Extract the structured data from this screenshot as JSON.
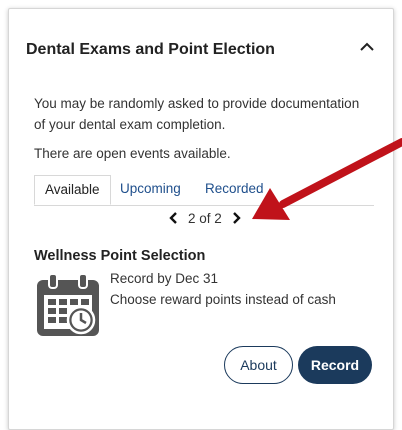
{
  "card": {
    "title": "Dental Exams and Point Election",
    "collapse_icon": "chevron-up-icon",
    "description": "You may be randomly asked to provide documentation of your dental exam completion.",
    "events_note": "There are open events available."
  },
  "tabs": [
    {
      "label": "Available",
      "active": true
    },
    {
      "label": "Upcoming",
      "active": false
    },
    {
      "label": "Recorded",
      "active": false
    }
  ],
  "pager": {
    "text": "2 of 2",
    "prev_icon": "chevron-left-icon",
    "next_icon": "chevron-right-icon"
  },
  "annotation": {
    "color": "#c0121a",
    "icon": "red-arrow-pointer"
  },
  "item": {
    "title": "Wellness Point Selection",
    "icon": "calendar-clock-icon",
    "record_by": "Record by Dec 31",
    "detail": "Choose reward points instead of cash"
  },
  "buttons": {
    "about": "About",
    "record": "Record"
  },
  "colors": {
    "primary": "#1b3a5c",
    "link": "#1f4f8c",
    "arrow": "#c0121a"
  }
}
